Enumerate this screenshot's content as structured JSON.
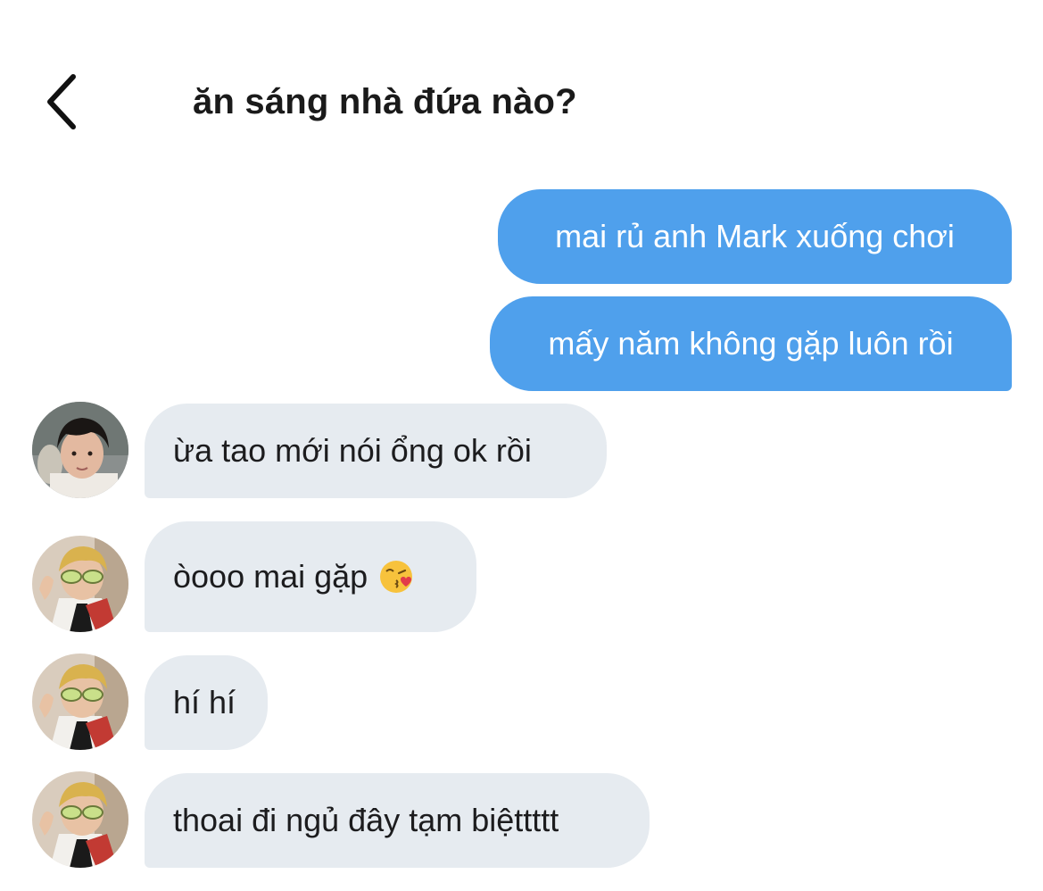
{
  "header": {
    "back_icon": "chevron-left-icon",
    "title": "ăn sáng nhà đứa nào?"
  },
  "messages": [
    {
      "direction": "out",
      "text": "mai rủ anh Mark xuống chơi"
    },
    {
      "direction": "out",
      "text": "mấy năm không gặp luôn rồi"
    },
    {
      "direction": "in",
      "sender_avatar": "avatar-dark-hair",
      "text": "ừa tao mới nói ổng ok rồi"
    },
    {
      "direction": "in",
      "sender_avatar": "avatar-sunglasses",
      "text": "òooo mai gặp",
      "emoji": "kissing-heart-emoji"
    },
    {
      "direction": "in",
      "sender_avatar": "avatar-sunglasses",
      "text": "hí hí"
    },
    {
      "direction": "in",
      "sender_avatar": "avatar-sunglasses",
      "text": "thoai đi ngủ đây tạm biệttttt"
    }
  ],
  "colors": {
    "outgoing_bubble": "#4fa0ec",
    "incoming_bubble": "#e6ebf0",
    "text_dark": "#1c1c1e",
    "text_light": "#ffffff"
  }
}
